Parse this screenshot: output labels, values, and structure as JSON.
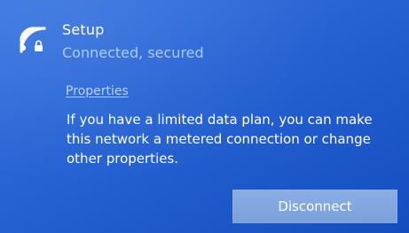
{
  "network": {
    "name": "Setup",
    "status": "Connected, secured",
    "icon": "wifi-secured-icon"
  },
  "properties_link": "Properties",
  "description": "If you have a limited data plan, you can make this network a metered connection or change other properties.",
  "disconnect_label": "Disconnect",
  "colors": {
    "background": "#1f5fd6",
    "status_text": "#a9c9ff",
    "link_text": "#b7d2ff",
    "button_bg": "#86a9e2"
  }
}
